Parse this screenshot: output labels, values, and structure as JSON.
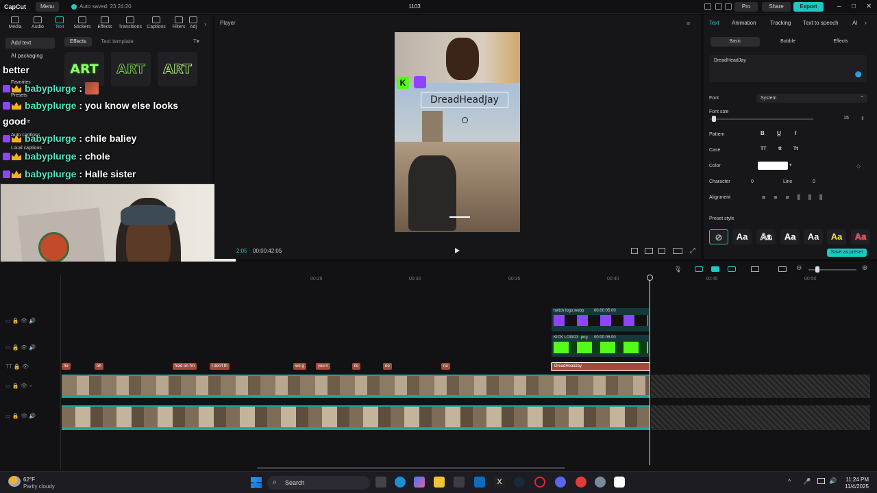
{
  "app": {
    "logo": "CapCut",
    "menu_label": "Menu",
    "autosave": "Auto saved: 23:24:20",
    "project_title": "1103",
    "pro_label": "Pro",
    "share_label": "Share",
    "export_label": "Export"
  },
  "left_tabs": [
    "Media",
    "Audio",
    "Text",
    "Stickers",
    "Effects",
    "Transitions",
    "Captions",
    "Filters",
    "Adj"
  ],
  "left_side": {
    "add_text": "Add text",
    "ai_packaging": "AI packaging",
    "favorites": "Favorites",
    "presets": "Presets",
    "template": "Template",
    "auto_captions": "Auto captions",
    "local_captions": "Local captions"
  },
  "left_chips": {
    "effects": "Effects",
    "text_template": "Text template"
  },
  "art_tiles": [
    "ART",
    "ART",
    "ART"
  ],
  "chat": {
    "lines": [
      {
        "user": "",
        "text": "better"
      },
      {
        "user": "babyplurge",
        "text": " : "
      },
      {
        "user": "babyplurge",
        "text": " : you know else looks"
      },
      {
        "user": "",
        "text": "good"
      },
      {
        "user": "babyplurge",
        "text": " : chile baliey"
      },
      {
        "user": "babyplurge",
        "text": " : chole"
      },
      {
        "user": "babyplurge",
        "text": " : Halle sister"
      }
    ]
  },
  "player": {
    "label": "Player",
    "overlay_text": "DreadHeadJay",
    "timecode": "00:00:42:05",
    "timecode_prefix": "2:05"
  },
  "right_tabs": [
    "Text",
    "Animation",
    "Tracking",
    "Text to speech",
    "AI"
  ],
  "sub_tabs": [
    "Basic",
    "Bubble",
    "Effects"
  ],
  "props": {
    "text_value": "DreadHeadJay",
    "font_label": "Font",
    "font_value": "System",
    "font_size_label": "Font size",
    "font_size_value": "15",
    "pattern_label": "Pattern",
    "case_label": "Case",
    "color_label": "Color",
    "character_label": "Character",
    "character_value": "0",
    "line_label": "Line",
    "line_value": "0",
    "alignment_label": "Alignment",
    "preset_label": "Preset style",
    "save_preset": "Save as preset"
  },
  "pattern_buttons": [
    "B",
    "U",
    "I"
  ],
  "case_buttons": [
    "TT",
    "tt",
    "Tt"
  ],
  "preset_tiles": [
    "Aa",
    "Aa",
    "Aa",
    "Aa",
    "Aa",
    "Aa"
  ],
  "timeline": {
    "ruler": [
      "00:25",
      "00:30",
      "00:35",
      "00:40",
      "00:45",
      "00:50"
    ],
    "twitch_clip": "twitch logo.webp",
    "twitch_dur": "00:00:05:00",
    "kick_clip": "KICK LOGO3 .png",
    "kick_dur": "00:00:05:00",
    "selected_text_clip": "DreadHeadJay",
    "text_clips": [
      "he",
      "oh",
      "hold on I'm",
      "I don't th",
      "we g",
      "you n",
      "its",
      "no",
      "no"
    ]
  },
  "taskbar": {
    "temp": "62°F",
    "weather": "Partly cloudy",
    "search": "Search",
    "time": "11:24 PM",
    "date": "11/4/2025"
  },
  "colors": {
    "accent": "#22c8c4",
    "text_clip": "#a7483c",
    "twitch": "#8e45ff",
    "kick": "#53fc18"
  }
}
